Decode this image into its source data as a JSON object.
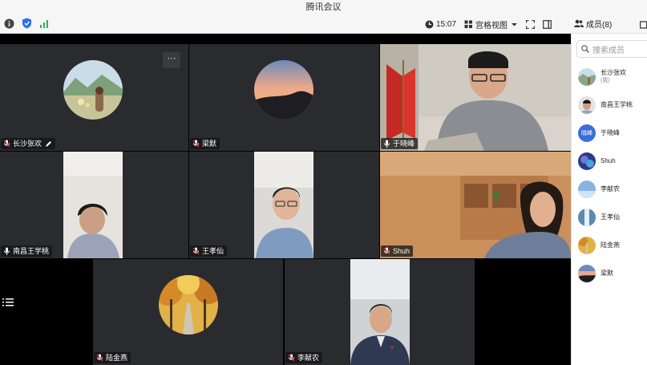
{
  "app": {
    "title": "腾讯会议"
  },
  "toolbar": {
    "time": "15:07",
    "view_label": "宫格视图",
    "members_label": "成员(8)"
  },
  "search": {
    "placeholder": "搜索成员"
  },
  "tiles": [
    {
      "name": "长沙张欢"
    },
    {
      "name": "梁默"
    },
    {
      "name": "于晓峰"
    },
    {
      "name": "南昌王学桃"
    },
    {
      "name": "王孝仙"
    },
    {
      "name": "Shuh"
    },
    {
      "name": "陆金燕"
    },
    {
      "name": "李献农"
    }
  ],
  "more_label": "···",
  "members": [
    {
      "name": "长沙张欢",
      "sub": "(我)"
    },
    {
      "name": "南昌王学桃"
    },
    {
      "name": "于晓峰",
      "avatar_text": "晓峰"
    },
    {
      "name": "Shuh"
    },
    {
      "name": "李献农"
    },
    {
      "name": "王孝仙"
    },
    {
      "name": "陆金燕"
    },
    {
      "name": "梁默"
    }
  ],
  "colors": {
    "active_border": "#2bc95b",
    "avatar_blue": "#3b6fd8"
  }
}
